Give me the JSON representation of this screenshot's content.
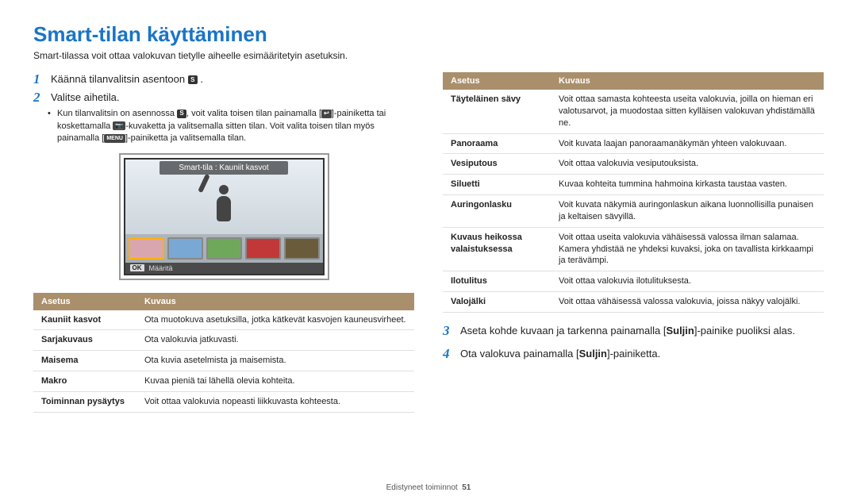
{
  "title": "Smart-tilan käyttäminen",
  "subtitle": "Smart-tilassa voit ottaa valokuvan tietylle aiheelle esimääritetyin asetuksin.",
  "steps": {
    "s1_pre": "Käännä tilanvalitsin asentoon ",
    "s1_icon": "S",
    "s1_post": " .",
    "s2": "Valitse aihetila.",
    "bullet_a": "Kun tilanvalitsin on asennossa ",
    "bullet_b": ", voit valita toisen tilan painamalla [",
    "bullet_c": "]-painiketta tai koskettamalla ",
    "bullet_d": "-kuvaketta ja valitsemalla sitten tilan. Voit valita toisen tilan myös painamalla [",
    "bullet_e": "]-painiketta ja valitsemalla tilan.",
    "s3_pre": "Aseta kohde kuvaan ja tarkenna painamalla [",
    "s3_bold": "Suljin",
    "s3_post": "]-painike puoliksi alas.",
    "s4_pre": "Ota valokuva painamalla [",
    "s4_bold": "Suljin",
    "s4_post": "]-painiketta."
  },
  "screenshot": {
    "title": "Smart-tila : Kauniit kasvot",
    "ok": "OK",
    "footer": "Määritä"
  },
  "table_header": {
    "col1": "Asetus",
    "col2": "Kuvaus"
  },
  "left_table": [
    {
      "k": "Kauniit kasvot",
      "v": "Ota muotokuva asetuksilla, jotka kätkevät kasvojen kauneusvirheet."
    },
    {
      "k": "Sarjakuvaus",
      "v": "Ota valokuvia jatkuvasti."
    },
    {
      "k": "Maisema",
      "v": "Ota kuvia asetelmista ja maisemista."
    },
    {
      "k": "Makro",
      "v": "Kuvaa pieniä tai lähellä olevia kohteita."
    },
    {
      "k": "Toiminnan pysäytys",
      "v": "Voit ottaa valokuvia nopeasti liikkuvasta kohteesta."
    }
  ],
  "right_table": [
    {
      "k": "Täyteläinen sävy",
      "v": "Voit ottaa samasta kohteesta useita valokuvia, joilla on hieman eri valotusarvot, ja muodostaa sitten kylläisen valokuvan yhdistämällä ne."
    },
    {
      "k": "Panoraama",
      "v": "Voit kuvata laajan panoraamanäkymän yhteen valokuvaan."
    },
    {
      "k": "Vesiputous",
      "v": "Voit ottaa valokuvia vesiputouksista."
    },
    {
      "k": "Siluetti",
      "v": "Kuvaa kohteita tummina hahmoina kirkasta taustaa vasten."
    },
    {
      "k": "Auringonlasku",
      "v": "Voit kuvata näkymiä auringonlaskun aikana luonnollisilla punaisen ja keltaisen sävyillä."
    },
    {
      "k": "Kuvaus heikossa valaistuksessa",
      "v": "Voit ottaa useita valokuvia vähäisessä valossa ilman salamaa. Kamera yhdistää ne yhdeksi kuvaksi, joka on tavallista kirkkaampi ja terävämpi."
    },
    {
      "k": "Ilotulitus",
      "v": "Voit ottaa valokuvia ilotulituksesta."
    },
    {
      "k": "Valojälki",
      "v": "Voit ottaa vähäisessä valossa valokuvia, joissa näkyy valojälki."
    }
  ],
  "icons": {
    "return": "↩",
    "camera": "📷",
    "menu": "MENU"
  },
  "footer": {
    "section": "Edistyneet toiminnot",
    "page": "51"
  }
}
